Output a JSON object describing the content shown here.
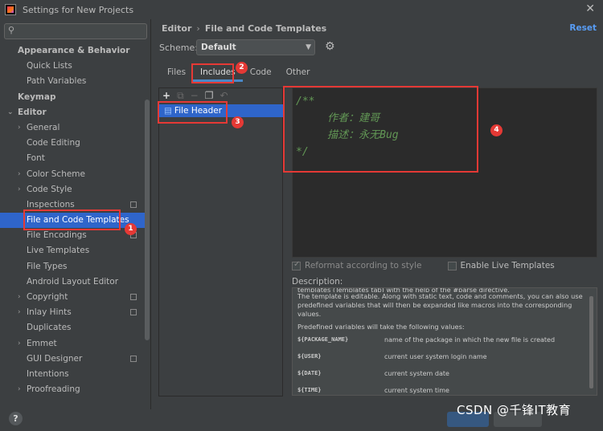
{
  "window": {
    "title": "Settings for New Projects",
    "close": "✕"
  },
  "search": {
    "placeholder": "",
    "icon": "search-icon"
  },
  "tree": [
    {
      "label": "Appearance & Behavior",
      "level": 0,
      "arrow": ""
    },
    {
      "label": "Quick Lists",
      "level": 1,
      "arrow": ""
    },
    {
      "label": "Path Variables",
      "level": 1,
      "arrow": ""
    },
    {
      "label": "Keymap",
      "level": 0,
      "arrow": ""
    },
    {
      "label": "Editor",
      "level": 0,
      "arrow": "⌄"
    },
    {
      "label": "General",
      "level": 1,
      "arrow": "›"
    },
    {
      "label": "Code Editing",
      "level": 1,
      "arrow": ""
    },
    {
      "label": "Font",
      "level": 1,
      "arrow": ""
    },
    {
      "label": "Color Scheme",
      "level": 1,
      "arrow": "›"
    },
    {
      "label": "Code Style",
      "level": 1,
      "arrow": "›"
    },
    {
      "label": "Inspections",
      "level": 1,
      "arrow": "",
      "proj": true
    },
    {
      "label": "File and Code Templates",
      "level": 1,
      "arrow": "",
      "selected": true
    },
    {
      "label": "File Encodings",
      "level": 1,
      "arrow": "",
      "proj": true
    },
    {
      "label": "Live Templates",
      "level": 1,
      "arrow": ""
    },
    {
      "label": "File Types",
      "level": 1,
      "arrow": ""
    },
    {
      "label": "Android Layout Editor",
      "level": 1,
      "arrow": ""
    },
    {
      "label": "Copyright",
      "level": 1,
      "arrow": "›",
      "proj": true
    },
    {
      "label": "Inlay Hints",
      "level": 1,
      "arrow": "›",
      "proj": true
    },
    {
      "label": "Duplicates",
      "level": 1,
      "arrow": ""
    },
    {
      "label": "Emmet",
      "level": 1,
      "arrow": "›"
    },
    {
      "label": "GUI Designer",
      "level": 1,
      "arrow": "",
      "proj": true
    },
    {
      "label": "Intentions",
      "level": 1,
      "arrow": ""
    },
    {
      "label": "Proofreading",
      "level": 1,
      "arrow": "›"
    }
  ],
  "breadcrumb": {
    "root": "Editor",
    "sep": "›",
    "current": "File and Code Templates"
  },
  "reset_label": "Reset",
  "scheme": {
    "label": "Scheme:",
    "value": "Default"
  },
  "tabs": [
    {
      "label": "Files",
      "active": false
    },
    {
      "label": "Includes",
      "active": true
    },
    {
      "label": "Code",
      "active": false
    },
    {
      "label": "Other",
      "active": false
    }
  ],
  "toolbar": {
    "add": "+",
    "remove": "−"
  },
  "templates": [
    {
      "name": "File Header"
    }
  ],
  "editor_lines": [
    "/**",
    "     作者：建哥",
    "     描述：永无Bug",
    "*/"
  ],
  "options": {
    "reformat": "Reformat according to style",
    "live": "Enable Live Templates"
  },
  "description": {
    "label": "Description:",
    "cut_line": "templates (Templates tab) with the help of the #parse directive.",
    "para1": "The template is editable. Along with static text, code and comments, you can also use predefined variables that will then be expanded like macros into the corresponding values.",
    "para2": "Predefined variables will take the following values:",
    "vars": [
      {
        "name": "${PACKAGE_NAME}",
        "desc": "name of the package in which the new file is created"
      },
      {
        "name": "${USER}",
        "desc": "current user system login name"
      },
      {
        "name": "${DATE}",
        "desc": "current system date"
      },
      {
        "name": "${TIME}",
        "desc": "current system time"
      }
    ]
  },
  "help_label": "?",
  "watermark": "CSDN @千锋IT教育",
  "annotations": [
    "1",
    "2",
    "3",
    "4"
  ],
  "colors": {
    "selection": "#2f65ca",
    "accent": "#4a88c7",
    "link": "#589df6",
    "annotation": "#e53935",
    "comment": "#629755"
  }
}
